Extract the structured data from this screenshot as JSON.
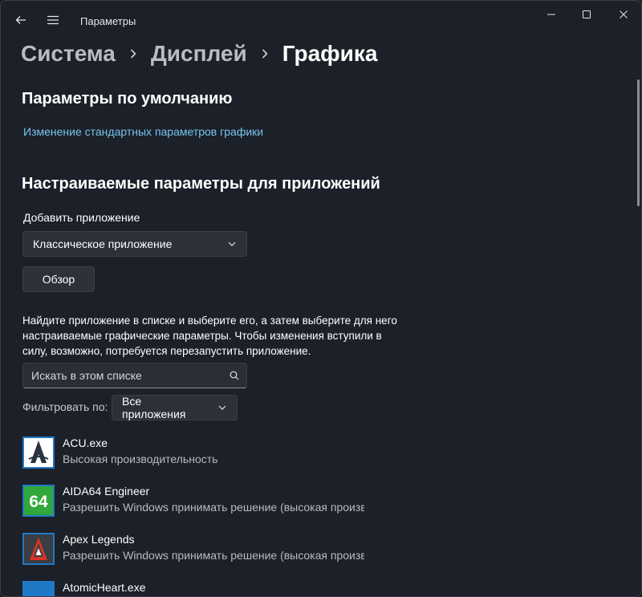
{
  "window": {
    "title": "Параметры"
  },
  "breadcrumb": {
    "items": [
      "Система",
      "Дисплей"
    ],
    "current": "Графика"
  },
  "defaults": {
    "heading": "Параметры по умолчанию",
    "link": "Изменение стандартных параметров графики"
  },
  "custom": {
    "heading": "Настраиваемые параметры для приложений",
    "add_label": "Добавить приложение",
    "app_type_selected": "Классическое приложение",
    "browse_label": "Обзор",
    "description": "Найдите приложение в списке и выберите его, а затем выберите для него настраиваемые графические параметры. Чтобы изменения вступили в силу, возможно, потребуется перезапустить приложение.",
    "search_placeholder": "Искать в этом списке",
    "filter_label": "Фильтровать по:",
    "filter_selected": "Все приложения"
  },
  "apps": [
    {
      "name": "ACU.exe",
      "status": "Высокая производительность",
      "icon": "assassins-creed-icon"
    },
    {
      "name": "AIDA64 Engineer",
      "status": "Разрешить Windows принимать решение (высокая производительность)",
      "icon": "aida64-icon"
    },
    {
      "name": "Apex Legends",
      "status": "Разрешить Windows принимать решение (высокая производительность)",
      "icon": "apex-legends-icon"
    },
    {
      "name": "AtomicHeart.exe",
      "status": "",
      "icon": "default-app-icon"
    }
  ],
  "colors": {
    "accent_link": "#76c5ee",
    "background": "#1c2028",
    "control": "#2c3039"
  }
}
